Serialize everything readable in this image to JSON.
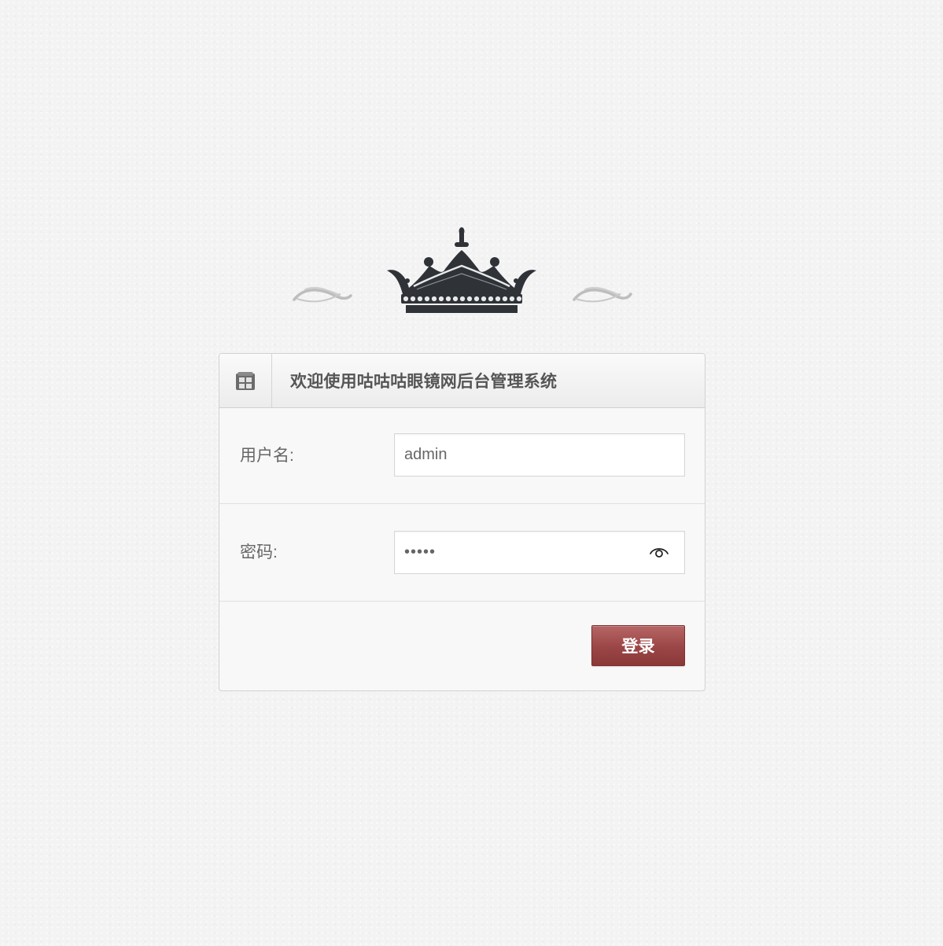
{
  "header": {
    "title": "欢迎使用咕咕咕眼镜网后台管理系统",
    "icon": "home-icon"
  },
  "logo": {
    "icon": "crown-icon",
    "color": "#2f3338"
  },
  "form": {
    "username": {
      "label": "用户名:",
      "value": "admin"
    },
    "password": {
      "label": "密码:",
      "value": "•••••",
      "toggle_icon": "eye-icon"
    },
    "submit_label": "登录"
  },
  "colors": {
    "button": "#9b4646",
    "background": "#f3f3f3"
  }
}
